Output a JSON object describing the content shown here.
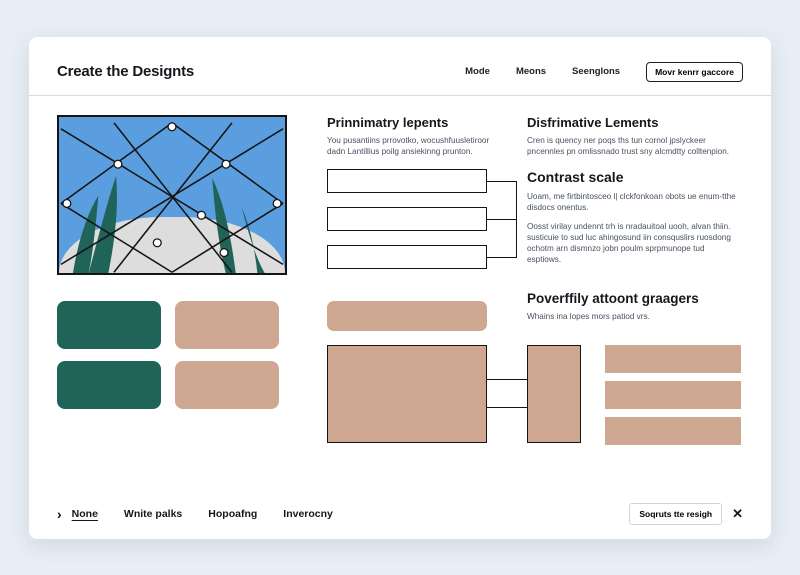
{
  "header": {
    "title": "Create the Designts",
    "nav": {
      "mode": "Mode",
      "means": "Meons",
      "sengions": "Seenglons"
    },
    "cta_label": "Movr kenrr gaccore"
  },
  "left": {
    "swatch_colors": {
      "teal": "#1f6359",
      "tan": "#cda78f"
    }
  },
  "mid": {
    "h1": "Prinnimatry lepents",
    "p1": "You pusantiins prrovotko, wocushfuusletiroor dadn Lantillius poilg ansiekinng prunton.",
    "big_tan_color": "#cda78f"
  },
  "right": {
    "h1": "Disfrimative Lements",
    "p1": "Cren is quency ner poqs ths tun cornol jpslyckeer pncennles pn omlissnado trust sny alcmdtty colltenpion.",
    "h2": "Contrast  scale",
    "p2": "Uoam, me firtbintosceo l| clckfonkoan obots ue enum-tthe disdocs onentus.",
    "p3": "Oosst virilay undennt trh is nradauitoal uooh, alvan thiin. susticuie to sud luc ahingosund iin consquslirs ruosdong ochotm arn dismnzo jobn poulm sprpmunope tud esptiows.",
    "h3": "Poverffily attoont graagers",
    "p4": "Whains ina lopes mors patiod vrs."
  },
  "footer": {
    "tabs": [
      "None",
      "Wnite palks",
      "Hopoafng",
      "Inverocny"
    ],
    "active_index": 0,
    "pill": "Soqruts tte resigh"
  }
}
